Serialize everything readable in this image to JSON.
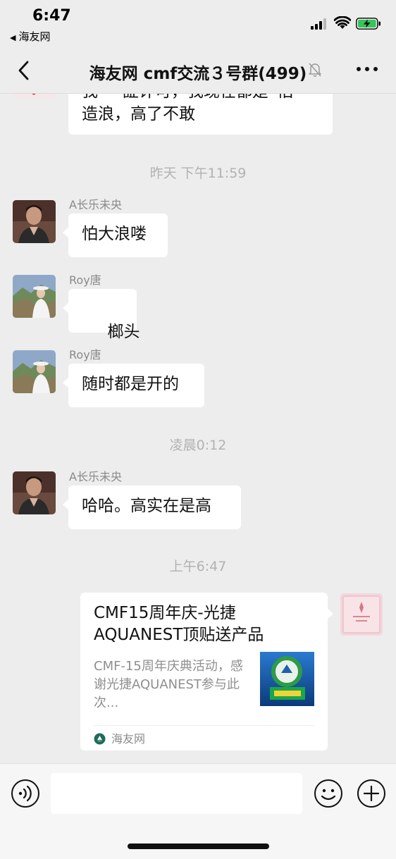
{
  "status_bar": {
    "time": "6:47",
    "back_app_label": "海友网"
  },
  "header": {
    "title": "海友网 cmf交流３号群(499)",
    "back_icon": "chevron-left-icon",
    "mute_icon": "bell-muted-icon",
    "more_icon": "more-dots-icon"
  },
  "messages": {
    "m0": {
      "text_line1": "我“一証计可，我现在都是“怕",
      "text_line2": "造浪，高了不敢"
    },
    "ts1": "昨天 下午11:59",
    "m1": {
      "sender": "A长乐未央",
      "text": "怕大浪喽"
    },
    "m2": {
      "sender": "Roy唐",
      "text": " 榔头"
    },
    "m3": {
      "sender": "Roy唐",
      "text": "随时都是开的"
    },
    "ts2": "凌晨0:12",
    "m4": {
      "sender": "A长乐未央",
      "text": "哈哈。高实在是高"
    },
    "ts3": "上午6:47",
    "card": {
      "title": "CMF15周年庆-光捷AQUANEST顶贴送产品",
      "description": "CMF-15周年庆典活动，感谢光捷AQUANEST参与此次...",
      "source": "海友网"
    }
  },
  "input_bar": {
    "voice_icon": "voice-icon",
    "emoji_icon": "emoji-icon",
    "plus_icon": "plus-icon",
    "input_value": ""
  },
  "colors": {
    "background": "#ededed",
    "bubble": "#ffffff",
    "timestamp": "#b2b2b2",
    "sender": "#8a8a8a"
  }
}
